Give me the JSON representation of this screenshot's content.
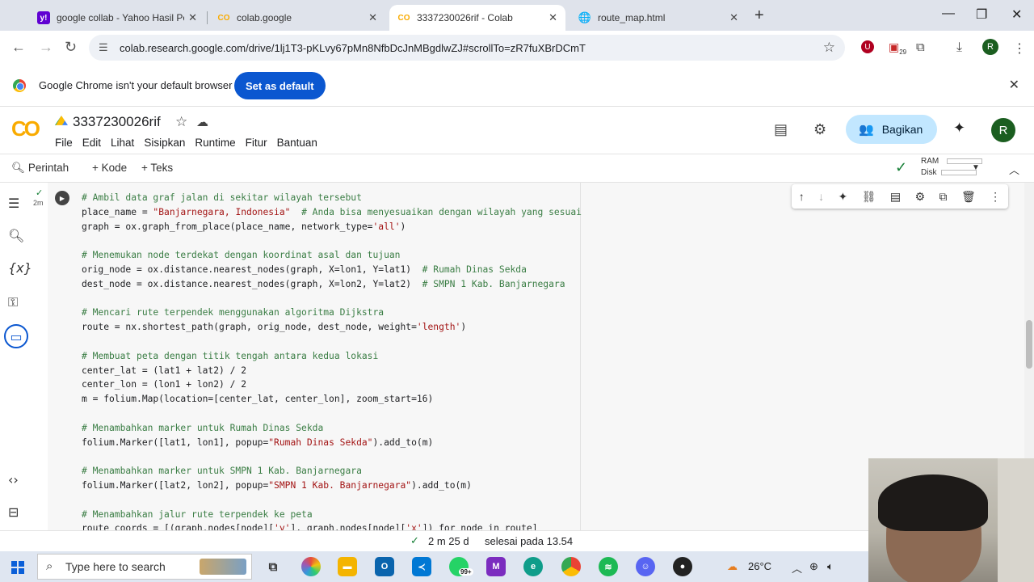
{
  "browser": {
    "tabs": [
      {
        "title": "google collab - Yahoo Hasil Pen",
        "icon": "yahoo-icon",
        "active": false
      },
      {
        "title": "colab.google",
        "icon": "colab-icon",
        "active": false
      },
      {
        "title": "3337230026rif - Colab",
        "icon": "colab-icon",
        "active": true
      },
      {
        "title": "route_map.html",
        "icon": "globe-icon",
        "active": false
      }
    ],
    "url": "colab.research.google.com/drive/1lj1T3-pKLvy67pMn8NfbDcJnMBgdlwZJ#scrollTo=zR7fuXBrDCmT",
    "extension_badge": "29",
    "profile_initial": "R"
  },
  "infobar": {
    "message": "Google Chrome isn't your default browser",
    "button": "Set as default"
  },
  "colab": {
    "notebook_name": "3337230026rif",
    "menu": [
      "File",
      "Edit",
      "Lihat",
      "Sisipkan",
      "Runtime",
      "Fitur",
      "Bantuan"
    ],
    "share_label": "Bagikan",
    "avatar_initial": "R",
    "toolbar": {
      "commands": "Perintah",
      "add_code": "+ Kode",
      "add_text": "+ Teks",
      "ram": "RAM",
      "disk": "Disk"
    },
    "cell": {
      "exec_time": "2m",
      "code_lines": [
        {
          "t": "# Ambil data graf jalan di sekitar wilayah tersebut",
          "k": "cmt"
        },
        {
          "t": "place_name = \"Banjarnegara, Indonesia\"  # Anda bisa menyesuaikan dengan wilayah yang sesuai",
          "k": "mix1"
        },
        {
          "t": "graph = ox.graph_from_place(place_name, network_type='all')",
          "k": "mix2"
        },
        {
          "t": "",
          "k": "plain"
        },
        {
          "t": "# Menemukan node terdekat dengan koordinat asal dan tujuan",
          "k": "cmt"
        },
        {
          "t": "orig_node = ox.distance.nearest_nodes(graph, X=lon1, Y=lat1)  # Rumah Dinas Sekda",
          "k": "mix3"
        },
        {
          "t": "dest_node = ox.distance.nearest_nodes(graph, X=lon2, Y=lat2)  # SMPN 1 Kab. Banjarnegara",
          "k": "mix3"
        },
        {
          "t": "",
          "k": "plain"
        },
        {
          "t": "# Mencari rute terpendek menggunakan algoritma Dijkstra",
          "k": "cmt"
        },
        {
          "t": "route = nx.shortest_path(graph, orig_node, dest_node, weight='length')",
          "k": "mix2"
        },
        {
          "t": "",
          "k": "plain"
        },
        {
          "t": "# Membuat peta dengan titik tengah antara kedua lokasi",
          "k": "cmt"
        },
        {
          "t": "center_lat = (lat1 + lat2) / 2",
          "k": "plain"
        },
        {
          "t": "center_lon = (lon1 + lon2) / 2",
          "k": "plain"
        },
        {
          "t": "m = folium.Map(location=[center_lat, center_lon], zoom_start=16)",
          "k": "plain"
        },
        {
          "t": "",
          "k": "plain"
        },
        {
          "t": "# Menambahkan marker untuk Rumah Dinas Sekda",
          "k": "cmt"
        },
        {
          "t": "folium.Marker([lat1, lon1], popup=\"Rumah Dinas Sekda\").add_to(m)",
          "k": "mix2"
        },
        {
          "t": "",
          "k": "plain"
        },
        {
          "t": "# Menambahkan marker untuk SMPN 1 Kab. Banjarnegara",
          "k": "cmt"
        },
        {
          "t": "folium.Marker([lat2, lon2], popup=\"SMPN 1 Kab. Banjarnegara\").add_to(m)",
          "k": "mix2"
        },
        {
          "t": "",
          "k": "plain"
        },
        {
          "t": "# Menambahkan jalur rute terpendek ke peta",
          "k": "cmt"
        },
        {
          "t": "route_coords = [(graph.nodes[node]['y'], graph.nodes[node]['x']) for node in route]",
          "k": "plain"
        }
      ]
    },
    "status": {
      "duration": "2 m 25 d",
      "finished": "selesai pada 13.54"
    }
  },
  "taskbar": {
    "search_placeholder": "Type here to search",
    "whatsapp_badge": "99+",
    "temperature": "26°C"
  },
  "colors": {
    "share_bg": "#c2e7ff",
    "set_default_bg": "#0b57d0",
    "comment": "#3a7d44",
    "string": "#a31515"
  }
}
